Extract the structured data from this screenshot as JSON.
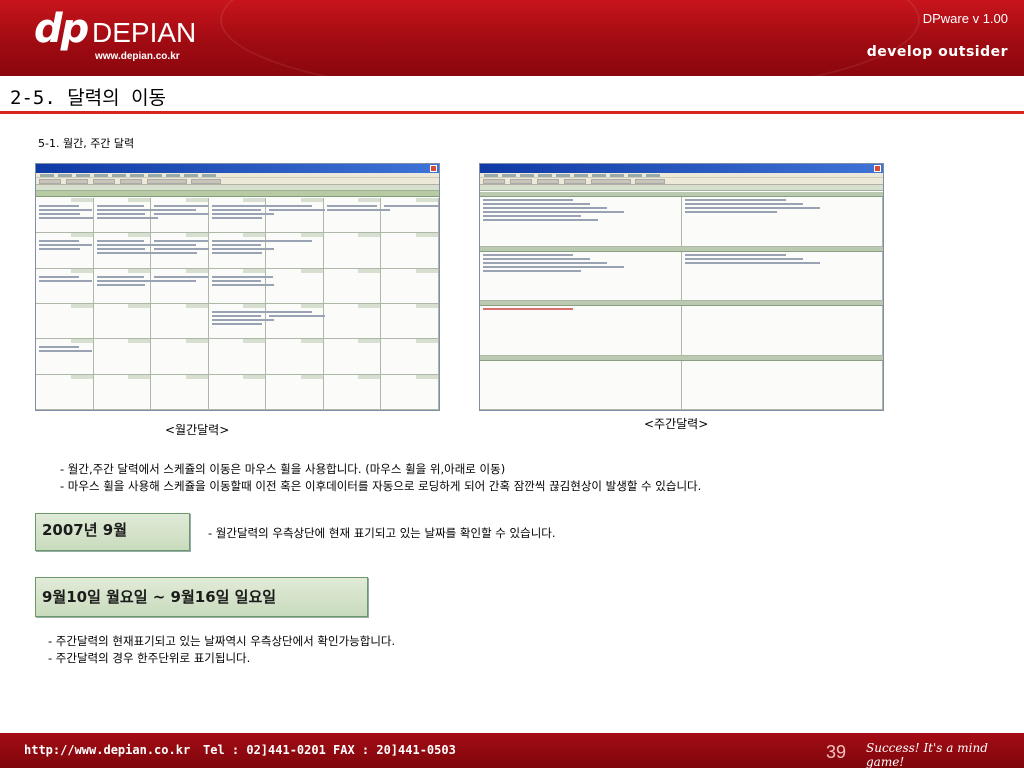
{
  "header": {
    "logo_mark": "dp",
    "logo_name": "DEPIAN",
    "logo_url": "www.depian.co.kr",
    "version": "DPware v 1.00",
    "tagline": "develop outsider"
  },
  "page": {
    "title": "2-5. 달력의 이동",
    "subtitle": "5-1. 월간, 주간 달력"
  },
  "screenshots": {
    "monthly_caption": "<월간달력>",
    "weekly_caption": "<주간달력>"
  },
  "notes": {
    "scroll": [
      "- 월간,주간 달력에서 스케쥴의 이동은 마우스 휠을 사용합니다. (마우스 휠을 위,아래로 이동)",
      "- 마우스 휠을 사용해 스케쥴을 이동할때 이전 혹은 이후데이터를 자동으로 로딩하게 되어 간혹 잠깐씩 끊김현상이 발생할 수 있습니다."
    ],
    "month_label": "2007년 9월",
    "month_note": "- 월간달력의 우측상단에 현재 표기되고 있는 날짜를 확인할 수 있습니다.",
    "week_label": "9월10일 월요일 ~ 9월16일 일요일",
    "week_notes": [
      "- 주간달력의 현재표기되고 있는 날짜역시 우측상단에서 확인가능합니다.",
      "- 주간달력의 경우 한주단위로 표기됩니다."
    ]
  },
  "footer": {
    "url": "http://www.depian.co.kr",
    "tel": "Tel : 02]441-0201",
    "fax": "FAX : 20]441-0503",
    "page_number": "39",
    "slogan": "Success! It's a mind game!"
  },
  "colors": {
    "brand_red": "#b3101a",
    "title_rule": "#d7251c",
    "label_green": "#c9dbbd"
  }
}
